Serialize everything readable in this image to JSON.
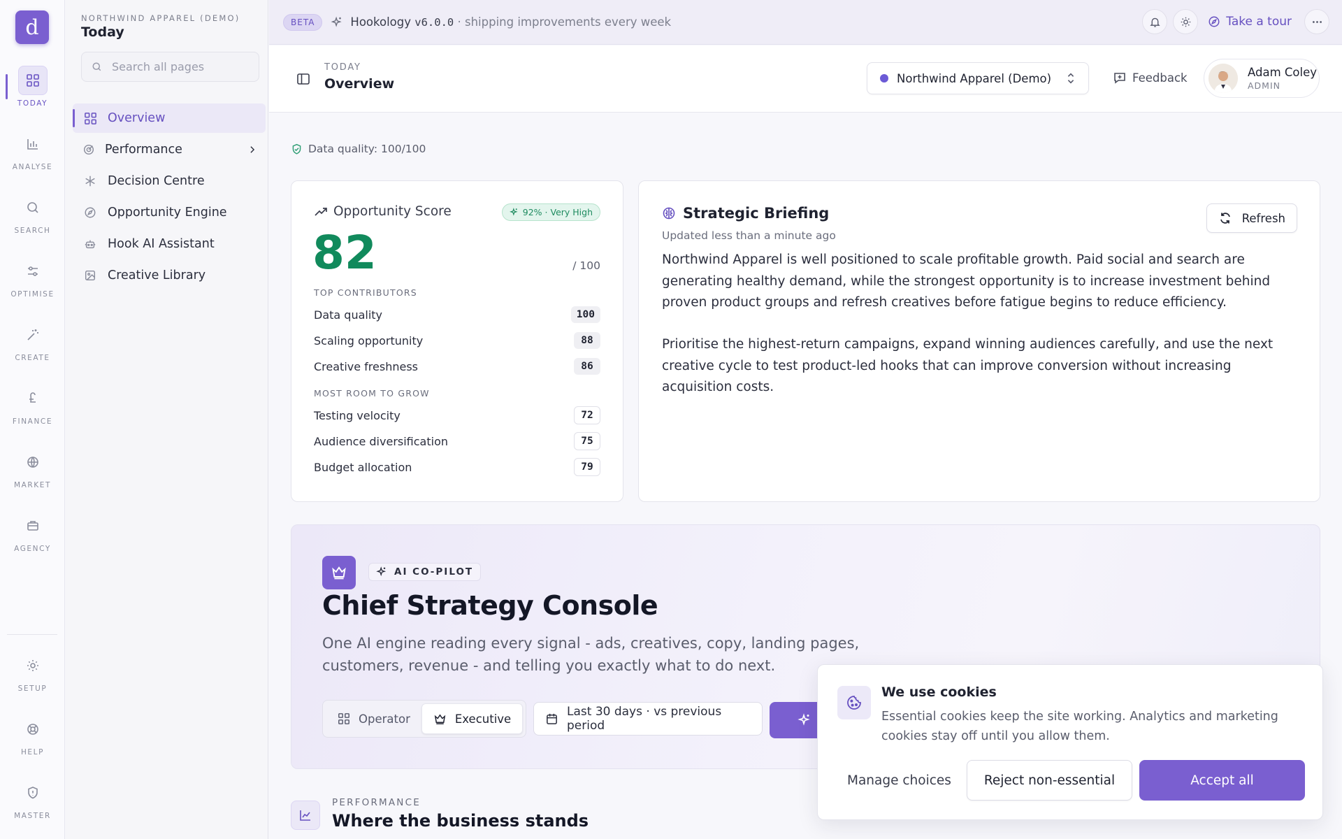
{
  "rail": {
    "logo": "d",
    "items": [
      {
        "label": "TODAY",
        "icon": "grid-icon"
      },
      {
        "label": "ANALYSE",
        "icon": "bar-chart-icon"
      },
      {
        "label": "SEARCH",
        "icon": "search-icon"
      },
      {
        "label": "OPTIMISE",
        "icon": "sliders-icon"
      },
      {
        "label": "CREATE",
        "icon": "magic-wand-icon"
      },
      {
        "label": "FINANCE",
        "icon": "pound-icon"
      },
      {
        "label": "MARKET",
        "icon": "globe-icon"
      },
      {
        "label": "AGENCY",
        "icon": "briefcase-icon"
      },
      {
        "label": "SETUP",
        "icon": "gear-icon"
      },
      {
        "label": "HELP",
        "icon": "lifebuoy-icon"
      },
      {
        "label": "MASTER",
        "icon": "shield-icon"
      }
    ]
  },
  "sidebar": {
    "org": "NORTHWIND APPAREL (DEMO)",
    "title": "Today",
    "search_placeholder": "Search all pages",
    "items": [
      {
        "label": "Overview",
        "icon": "grid-icon",
        "active": true
      },
      {
        "label": "Performance",
        "icon": "target-icon"
      },
      {
        "label": "Decision Centre",
        "icon": "asterisk-icon"
      },
      {
        "label": "Opportunity Engine",
        "icon": "compass-icon"
      },
      {
        "label": "Hook AI Assistant",
        "icon": "bot-icon"
      },
      {
        "label": "Creative Library",
        "icon": "images-icon"
      }
    ]
  },
  "banner": {
    "badge": "BETA",
    "product": "Hookology",
    "version": "v6.0.0",
    "tagline": "· shipping improvements every week",
    "tour": "Take a tour"
  },
  "header": {
    "eyebrow": "TODAY",
    "title": "Overview",
    "org_select": "Northwind Apparel (Demo)",
    "feedback": "Feedback",
    "user_name": "Adam Coley",
    "user_role": "ADMIN"
  },
  "data_quality": "Data quality: 100/100",
  "score": {
    "title": "Opportunity Score",
    "badge": "92% · Very High",
    "value": "82",
    "out_of": "/ 100",
    "top_label": "TOP CONTRIBUTORS",
    "top": [
      {
        "label": "Data quality",
        "value": "100"
      },
      {
        "label": "Scaling opportunity",
        "value": "88"
      },
      {
        "label": "Creative freshness",
        "value": "86"
      }
    ],
    "grow_label": "MOST ROOM TO GROW",
    "grow": [
      {
        "label": "Testing velocity",
        "value": "72"
      },
      {
        "label": "Audience diversification",
        "value": "75"
      },
      {
        "label": "Budget allocation",
        "value": "79"
      }
    ]
  },
  "briefing": {
    "title": "Strategic Briefing",
    "updated": "Updated less than a minute ago",
    "refresh": "Refresh",
    "p1": "Northwind Apparel is well positioned to scale profitable growth. Paid social and search are generating healthy demand, while the strongest opportunity is to increase investment behind proven product groups and refresh creatives before fatigue begins to reduce efficiency.",
    "p2": "Prioritise the highest-return campaigns, expand winning audiences carefully, and use the next creative cycle to test product-led hooks that can improve conversion without increasing acquisition costs."
  },
  "console": {
    "badge": "AI CO-PILOT",
    "title": "Chief Strategy Console",
    "desc": "One AI engine reading every signal - ads, creatives, copy, landing pages, customers, revenue - and telling you exactly what to do next.",
    "mode_operator": "Operator",
    "mode_executive": "Executive",
    "date_range": "Last 30 days · vs previous period"
  },
  "performance": {
    "eyebrow": "PERFORMANCE",
    "title": "Where the business stands"
  },
  "cookie": {
    "title": "We use cookies",
    "text": "Essential cookies keep the site working. Analytics and marketing cookies stay off until you allow them.",
    "manage": "Manage choices",
    "reject": "Reject non-essential",
    "accept": "Accept all"
  },
  "colors": {
    "accent": "#7a5fd0",
    "score_green": "#118a5c"
  }
}
